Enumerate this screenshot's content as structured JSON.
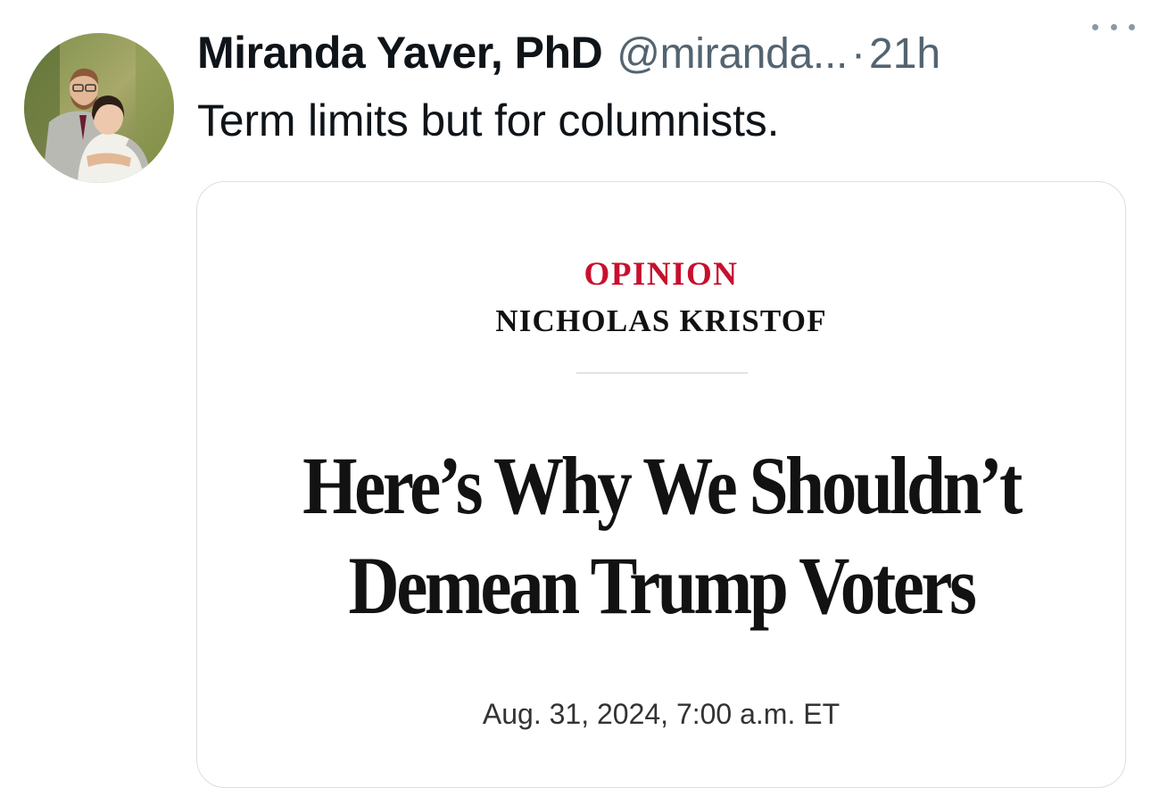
{
  "tweet": {
    "display_name": "Miranda Yaver, PhD",
    "handle": "@miranda...",
    "separator": "·",
    "time": "21h",
    "text": "Term limits but for columnists.",
    "more_icon": "more-horizontal-icon",
    "avatar_icon": "profile-photo"
  },
  "card": {
    "kicker": "OPINION",
    "byline": "NICHOLAS KRISTOF",
    "headline_line1": "Here’s Why We Shouldn’t",
    "headline_line2": "Demean Trump Voters",
    "date": "Aug. 31, 2024, 7:00 a.m. ET"
  },
  "colors": {
    "kicker_red": "#c8102e",
    "secondary_text": "#536471",
    "card_border": "#d9dfe3",
    "headline": "#121212"
  }
}
